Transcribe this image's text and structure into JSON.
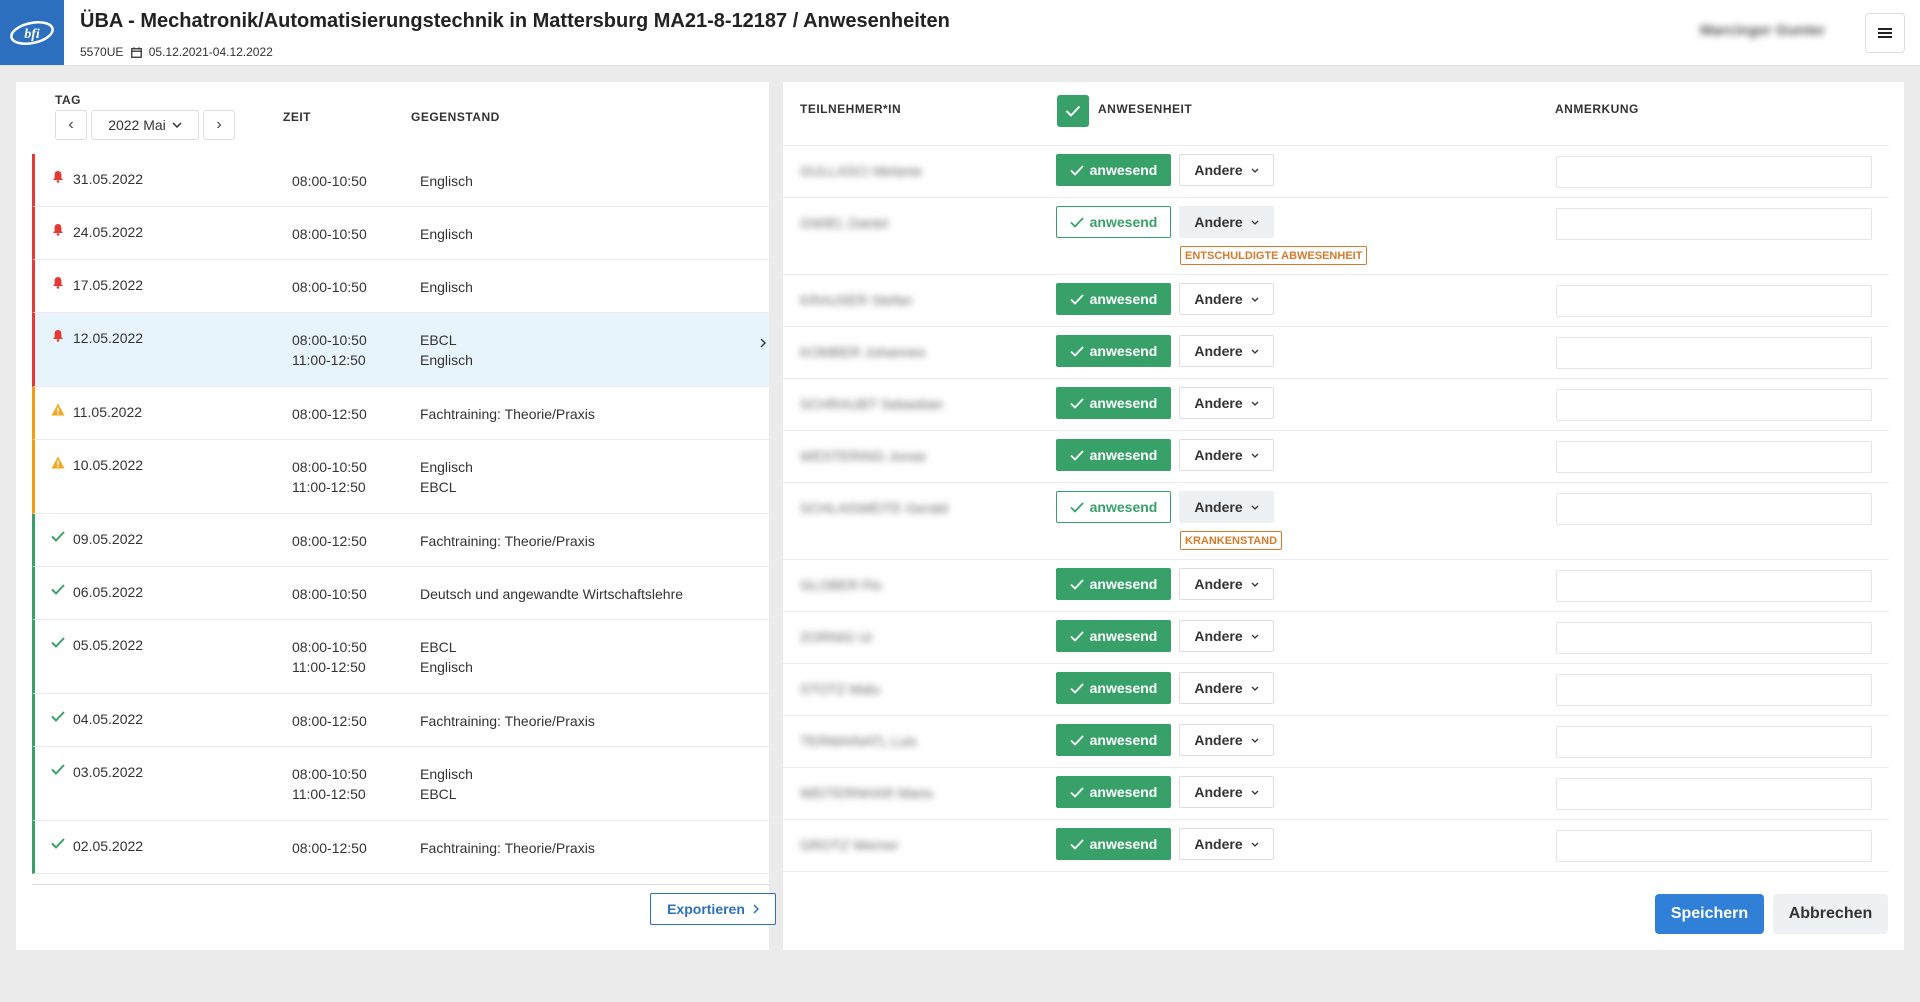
{
  "header": {
    "title": "ÜBA - Mechatronik/Automatisierungstechnik in Mattersburg MA21-8-12187 / Anwesenheiten",
    "units": "5570UE",
    "date_range": "05.12.2021-04.12.2022",
    "user_name": "Marcinger Gunter",
    "brand_color": "#2c6fbf"
  },
  "left": {
    "col_tag": "TAG",
    "col_zeit": "ZEIT",
    "col_gegenstand": "GEGENSTAND",
    "prev": "‹",
    "next": "›",
    "month": "2022 Mai",
    "days": [
      {
        "date": "31.05.2022",
        "status": "alert",
        "times": "08:00-10:50",
        "subjects": "Englisch"
      },
      {
        "date": "24.05.2022",
        "status": "alert",
        "times": "08:00-10:50",
        "subjects": "Englisch"
      },
      {
        "date": "17.05.2022",
        "status": "alert",
        "times": "08:00-10:50",
        "subjects": "Englisch"
      },
      {
        "date": "12.05.2022",
        "status": "alert",
        "times": "08:00-10:50\n11:00-12:50",
        "subjects": "EBCL\nEnglisch",
        "selected": true
      },
      {
        "date": "11.05.2022",
        "status": "warn",
        "times": "08:00-12:50",
        "subjects": "Fachtraining: Theorie/Praxis"
      },
      {
        "date": "10.05.2022",
        "status": "warn",
        "times": "08:00-10:50\n11:00-12:50",
        "subjects": "Englisch\nEBCL"
      },
      {
        "date": "09.05.2022",
        "status": "ok",
        "times": "08:00-12:50",
        "subjects": "Fachtraining: Theorie/Praxis"
      },
      {
        "date": "06.05.2022",
        "status": "ok",
        "times": "08:00-10:50",
        "subjects": "Deutsch und angewandte Wirtschaftslehre"
      },
      {
        "date": "05.05.2022",
        "status": "ok",
        "times": "08:00-10:50\n11:00-12:50",
        "subjects": "EBCL\nEnglisch"
      },
      {
        "date": "04.05.2022",
        "status": "ok",
        "times": "08:00-12:50",
        "subjects": "Fachtraining: Theorie/Praxis"
      },
      {
        "date": "03.05.2022",
        "status": "ok",
        "times": "08:00-10:50\n11:00-12:50",
        "subjects": "Englisch\nEBCL"
      },
      {
        "date": "02.05.2022",
        "status": "ok",
        "times": "08:00-12:50",
        "subjects": "Fachtraining: Theorie/Praxis"
      }
    ],
    "export_label": "Exportieren",
    "status_colors": {
      "alert": "#e53935",
      "warn": "#f39c12",
      "ok": "#38a169"
    }
  },
  "right": {
    "col_participant": "TEILNEHMER*IN",
    "col_attendance": "ANWESENHEIT",
    "col_remark": "ANMERKUNG",
    "present_label": "anwesend",
    "other_label": "Andere",
    "participants": [
      {
        "name": "GULLASCI Melanie",
        "state": "present",
        "badge": "",
        "remark": ""
      },
      {
        "name": "GWIEL Daniel",
        "state": "excused",
        "badge": "ENTSCHULDIGTE ABWESENHEIT",
        "remark": ""
      },
      {
        "name": "KRAUSER Stefan",
        "state": "present",
        "badge": "",
        "remark": ""
      },
      {
        "name": "KOMBER Johannes",
        "state": "present",
        "badge": "",
        "remark": ""
      },
      {
        "name": "SCHRAUBT Sebastian",
        "state": "present",
        "badge": "",
        "remark": ""
      },
      {
        "name": "WESTERING Jonas",
        "state": "present",
        "badge": "",
        "remark": ""
      },
      {
        "name": "SCHLAGWEITE Gerald",
        "state": "sick",
        "badge": "KRANKENSTAND",
        "remark": ""
      },
      {
        "name": "GLOBER Flo",
        "state": "present",
        "badge": "",
        "remark": ""
      },
      {
        "name": "ZORNIG Ui",
        "state": "present",
        "badge": "",
        "remark": ""
      },
      {
        "name": "STOTZ Malu",
        "state": "present",
        "badge": "",
        "remark": ""
      },
      {
        "name": "TERMAINATL Luis",
        "state": "present",
        "badge": "",
        "remark": ""
      },
      {
        "name": "WEITERNHAR Mario",
        "state": "present",
        "badge": "",
        "remark": ""
      },
      {
        "name": "GROTZ Werner",
        "state": "present",
        "badge": "",
        "remark": ""
      }
    ],
    "save_label": "Speichern",
    "cancel_label": "Abbrechen",
    "accent_green": "#38a169",
    "badge_color": "#d67a2c"
  }
}
